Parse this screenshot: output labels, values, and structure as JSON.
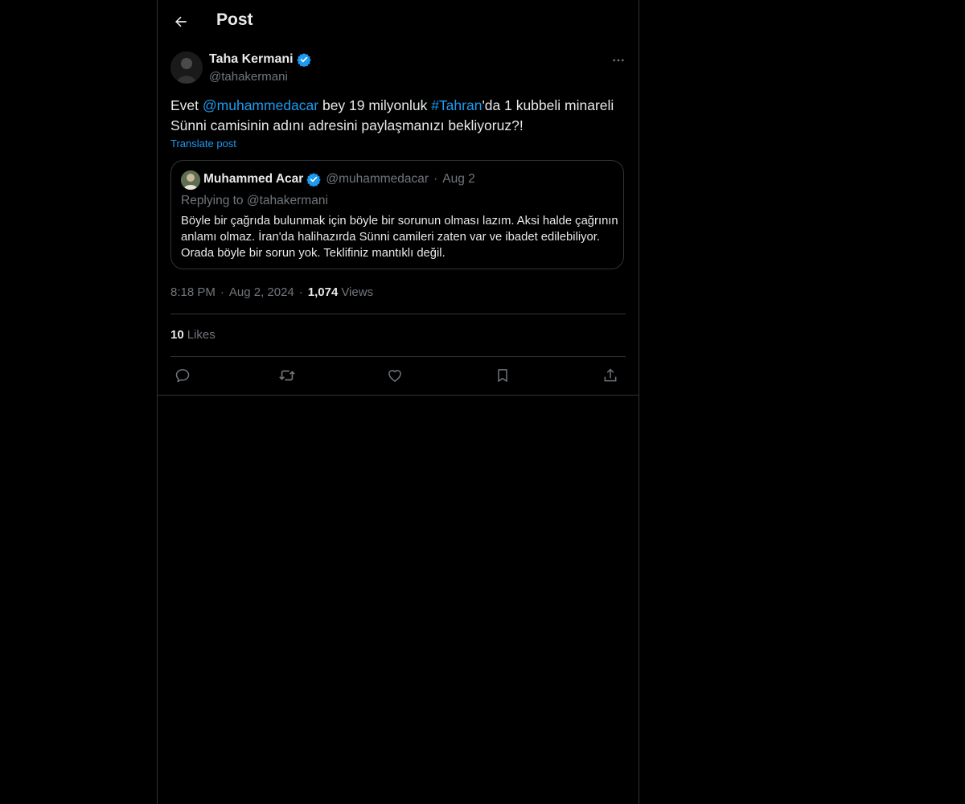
{
  "header": {
    "title": "Post"
  },
  "post": {
    "author_name": "Taha Kermani",
    "author_handle": "@tahakermani",
    "text_parts": {
      "p1": "Evet ",
      "mention": "@muhammedacar",
      "p2": " bey 19 milyonluk ",
      "hashtag": "#Tahran",
      "p3": "'da 1 kubbeli minareli Sünni camisinin adını adresini paylaşmanızı bekliyoruz?!"
    },
    "translate_label": "Translate post",
    "time": "8:18 PM",
    "date": "Aug 2, 2024",
    "views_count": "1,074",
    "views_label": "Views",
    "likes_count": "10",
    "likes_label": "Likes"
  },
  "quote": {
    "author_name": "Muhammed Acar",
    "author_handle": "@muhammedacar",
    "date": "Aug 2",
    "replying_to": "Replying to @tahakermani",
    "text": "Böyle bir çağrıda bulunmak için böyle bir sorunun olması lazım. Aksi halde çağrının anlamı olmaz. İran'da halihazırda Sünni camileri zaten var ve ibadet edilebiliyor. Orada böyle bir sorun yok. Teklifiniz mantıklı değil."
  },
  "separators": {
    "dot": "·"
  },
  "icons": {
    "back": "arrow-left-icon",
    "verified": "verified-badge-icon",
    "more": "more-dots-icon",
    "reply": "reply-icon",
    "repost": "repost-icon",
    "like": "heart-icon",
    "bookmark": "bookmark-icon",
    "share": "share-icon"
  },
  "colors": {
    "background": "#000000",
    "text": "#e7e9ea",
    "muted": "#71767b",
    "accent": "#1d9bf0",
    "border": "#2f3336"
  }
}
